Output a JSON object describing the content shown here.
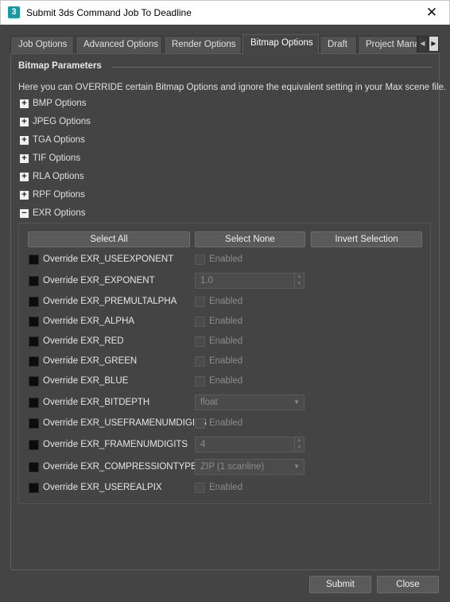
{
  "window": {
    "app_icon_glyph": "3",
    "title": "Submit 3ds Command Job To Deadline",
    "close_glyph": "✕"
  },
  "tabs": [
    {
      "label": "Job Options"
    },
    {
      "label": "Advanced Options"
    },
    {
      "label": "Render Options"
    },
    {
      "label": "Bitmap Options",
      "active": true
    },
    {
      "label": "Draft"
    },
    {
      "label": "Project Mana"
    }
  ],
  "tab_scroll": {
    "left_glyph": "◀",
    "right_glyph": "▶"
  },
  "section": {
    "title": "Bitmap Parameters",
    "description": "Here you can OVERRIDE certain Bitmap Options and ignore the equivalent setting in your Max scene file."
  },
  "tree": [
    {
      "expander": "+",
      "label": "BMP Options"
    },
    {
      "expander": "+",
      "label": "JPEG Options"
    },
    {
      "expander": "+",
      "label": "TGA Options"
    },
    {
      "expander": "+",
      "label": "TIF Options"
    },
    {
      "expander": "+",
      "label": "RLA Options"
    },
    {
      "expander": "+",
      "label": "RPF Options"
    },
    {
      "expander": "−",
      "label": "EXR Options"
    }
  ],
  "exr": {
    "select_all": "Select All",
    "select_none": "Select None",
    "invert_selection": "Invert Selection",
    "rows": [
      {
        "label": "Override EXR_USEEXPONENT",
        "control": "check",
        "value": "Enabled"
      },
      {
        "label": "Override EXR_EXPONENT",
        "control": "spin",
        "value": "1.0"
      },
      {
        "label": "Override EXR_PREMULTALPHA",
        "control": "check",
        "value": "Enabled"
      },
      {
        "label": "Override EXR_ALPHA",
        "control": "check",
        "value": "Enabled"
      },
      {
        "label": "Override EXR_RED",
        "control": "check",
        "value": "Enabled"
      },
      {
        "label": "Override EXR_GREEN",
        "control": "check",
        "value": "Enabled"
      },
      {
        "label": "Override EXR_BLUE",
        "control": "check",
        "value": "Enabled"
      },
      {
        "label": "Override EXR_BITDEPTH",
        "control": "combo",
        "value": "float"
      },
      {
        "label": "Override EXR_USEFRAMENUMDIGITS",
        "control": "check",
        "value": "Enabled"
      },
      {
        "label": "Override EXR_FRAMENUMDIGITS",
        "control": "spin",
        "value": "4"
      },
      {
        "label": "Override EXR_COMPRESSIONTYPE",
        "control": "combo",
        "value": "ZIP (1 scanline)"
      },
      {
        "label": "Override EXR_USEREALPIX",
        "control": "check",
        "value": "Enabled"
      }
    ]
  },
  "footer": {
    "submit": "Submit",
    "close": "Close"
  }
}
